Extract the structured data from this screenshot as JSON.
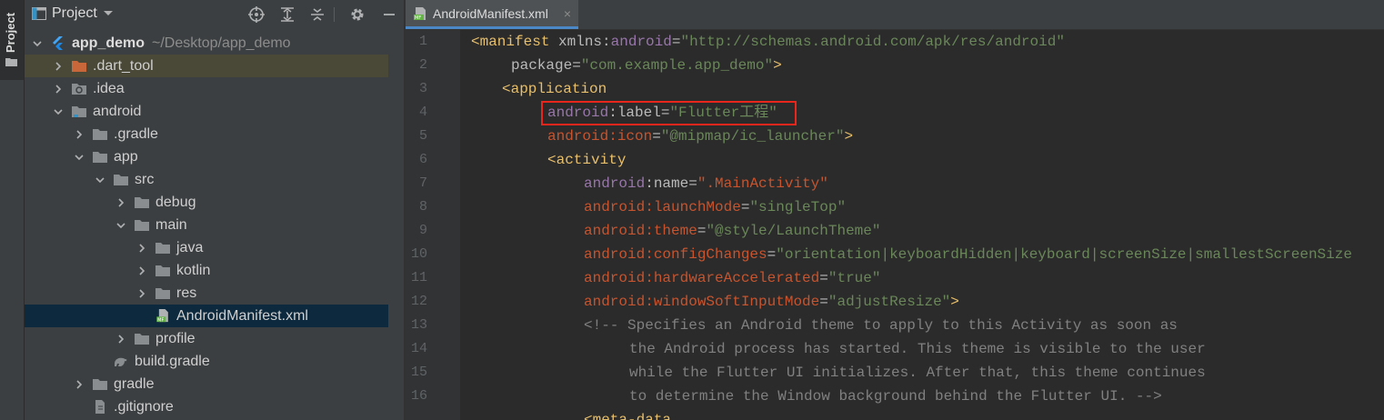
{
  "stripe": {
    "label": "Project"
  },
  "panel": {
    "title": "Project"
  },
  "tree": [
    {
      "label": "app_demo",
      "path": "~/Desktop/app_demo",
      "icon": "flutter-icon",
      "expanded": true,
      "bold": true
    },
    {
      "label": ".dart_tool",
      "icon": "folder-orange-icon",
      "expanded": false,
      "highlighted": true
    },
    {
      "label": ".idea",
      "icon": "folder-settings-icon",
      "expanded": false
    },
    {
      "label": "android",
      "icon": "folder-module-icon",
      "expanded": true
    },
    {
      "label": ".gradle",
      "icon": "folder-icon",
      "expanded": false
    },
    {
      "label": "app",
      "icon": "folder-icon",
      "expanded": true
    },
    {
      "label": "src",
      "icon": "folder-icon",
      "expanded": true
    },
    {
      "label": "debug",
      "icon": "folder-icon",
      "expanded": false
    },
    {
      "label": "main",
      "icon": "folder-icon",
      "expanded": true
    },
    {
      "label": "java",
      "icon": "folder-icon",
      "expanded": false
    },
    {
      "label": "kotlin",
      "icon": "folder-icon",
      "expanded": false
    },
    {
      "label": "res",
      "icon": "folder-icon",
      "expanded": false
    },
    {
      "label": "AndroidManifest.xml",
      "icon": "manifest-file-icon",
      "selected": true
    },
    {
      "label": "profile",
      "icon": "folder-icon",
      "expanded": false
    },
    {
      "label": "build.gradle",
      "icon": "gradle-icon"
    },
    {
      "label": "gradle",
      "icon": "folder-icon",
      "expanded": false
    },
    {
      "label": ".gitignore",
      "icon": "gitignore-icon"
    }
  ],
  "editor": {
    "tab_label": "AndroidManifest.xml",
    "tab_close": "×",
    "line_numbers": [
      "1",
      "2",
      "3",
      "4",
      "5",
      "6",
      "7",
      "8",
      "9",
      "10",
      "11",
      "12",
      "13",
      "14",
      "15",
      "16"
    ],
    "lines": [
      {
        "l": "<manifest",
        "a": " xmlns",
        "b": ":",
        "c": "android",
        "d": "=",
        "e": "\"http://schemas.android.com/apk/res/android\""
      },
      {
        "a": "package",
        "d": "=",
        "e": "\"com.example.app_demo\"",
        "f": ">"
      },
      {
        "l": "<application"
      },
      {
        "c": "android",
        "b": ":",
        "a": "label",
        "d": "=",
        "e": "\"Flutter工程\""
      },
      {
        "c": "android:icon",
        "d": "=",
        "e": "\"@mipmap/ic_launcher\"",
        "f": ">"
      },
      {
        "l": "<activity"
      },
      {
        "c": "android",
        "b": ":",
        "a": "name",
        "d": "=",
        "e": "\".MainActivity\""
      },
      {
        "c": "android:launchMode",
        "d": "=",
        "e": "\"singleTop\""
      },
      {
        "c": "android:theme",
        "d": "=",
        "e": "\"@style/LaunchTheme\""
      },
      {
        "c": "android:configChanges",
        "d": "=",
        "e": "\"orientation|keyboardHidden|keyboard|screenSize|smallestScreenSize"
      },
      {
        "c": "android:hardwareAccelerated",
        "d": "=",
        "e": "\"true\""
      },
      {
        "c": "android:windowSoftInputMode",
        "d": "=",
        "e": "\"adjustResize\"",
        "f": ">"
      },
      {
        "cmt": "<!-- Specifies an Android theme to apply to this Activity as soon as"
      },
      {
        "cmt": "the Android process has started. This theme is visible to the user"
      },
      {
        "cmt": "while the Flutter UI initializes. After that, this theme continues"
      },
      {
        "cmt": "to determine the Window background behind the Flutter UI. -->"
      }
    ],
    "line17_partial": "<meta-data"
  }
}
